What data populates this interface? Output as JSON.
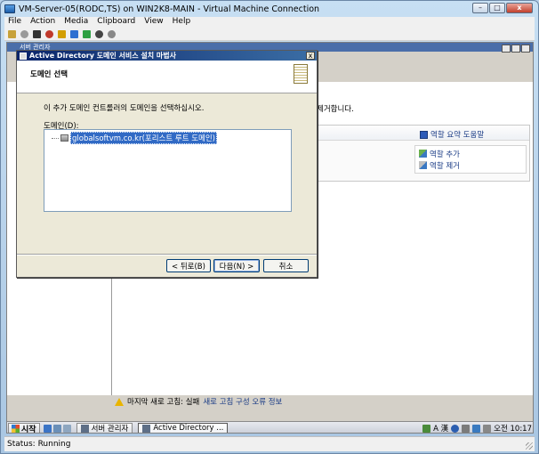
{
  "host": {
    "title": "VM-Server-05(RODC,TS) on WIN2K8-MAIN - Virtual Machine Connection",
    "menu": [
      "File",
      "Action",
      "Media",
      "Clipboard",
      "View",
      "Help"
    ],
    "status": "Status: Running",
    "window_buttons": {
      "minimize": "–",
      "maximize": "□",
      "close": "x"
    }
  },
  "server_manager": {
    "title": "서버 관리자",
    "description": "제거합니다.",
    "roles_help": "역할 요약 도움말",
    "actions": {
      "add": "역할 추가",
      "remove": "역할 제거"
    },
    "refresh": {
      "text": "마지막 새로 고침: 실패",
      "link": "새로 고침 구성 오류 정보"
    }
  },
  "dialog": {
    "title": "Active Directory 도메인 서비스 설치 마법사",
    "header": "도메인 선택",
    "instruction": "이 추가 도메인 컨트롤러의 도메인을 선택하십시오.",
    "domain_label": "도메인(D):",
    "domain_item": "globalsoftvm.co.kr(포리스트 루트 도메인)",
    "buttons": {
      "back": "< 뒤로(B)",
      "next": "다음(N) >",
      "cancel": "취소"
    },
    "close": "x"
  },
  "taskbar": {
    "start": "시작",
    "tasks": [
      "서버 관리자",
      "Active Directory ..."
    ],
    "tray_lang": "A 漢",
    "clock": "오전 10:17"
  }
}
